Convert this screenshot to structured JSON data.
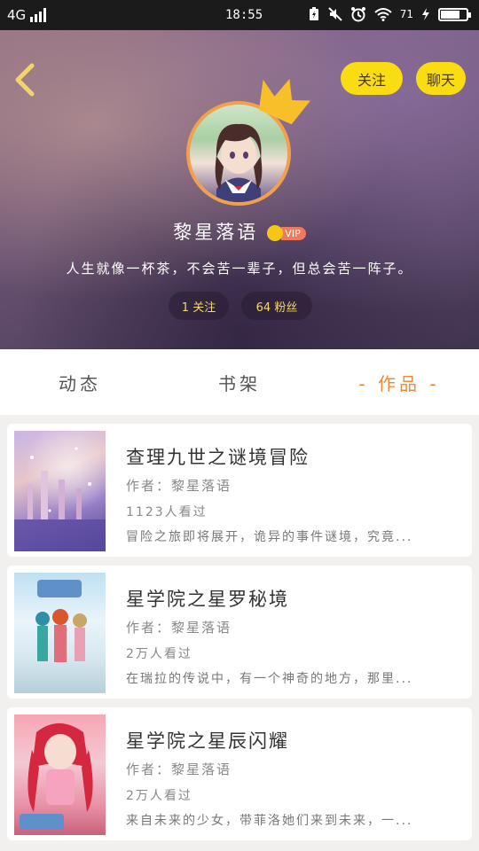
{
  "status_bar": {
    "network": "4G",
    "time": "18:55",
    "battery_text": "71"
  },
  "header": {
    "follow_label": "关注",
    "chat_label": "聊天",
    "nickname": "黎星落语",
    "vip_label": "VIP",
    "signature": "人生就像一杯茶，不会苦一辈子，但总会苦一阵子。",
    "following_count": "1 关注",
    "fans_count": "64 粉丝",
    "accent": "#f9dc12"
  },
  "tabs": [
    {
      "label": "动态"
    },
    {
      "label": "书架"
    },
    {
      "label": "- 作品 -"
    }
  ],
  "works": [
    {
      "title": "查理九世之谜境冒险",
      "author": "作者：黎星落语",
      "views": "1123人看过",
      "desc": "冒险之旅即将展开，诡异的事件谜境，究竟..."
    },
    {
      "title": "星学院之星罗秘境",
      "author": "作者：黎星落语",
      "views": "2万人看过",
      "desc": "在瑞拉的传说中，有一个神奇的地方，那里..."
    },
    {
      "title": "星学院之星辰闪耀",
      "author": "作者：黎星落语",
      "views": "2万人看过",
      "desc": "来自未来的少女，带菲洛她们来到未来，一..."
    }
  ]
}
